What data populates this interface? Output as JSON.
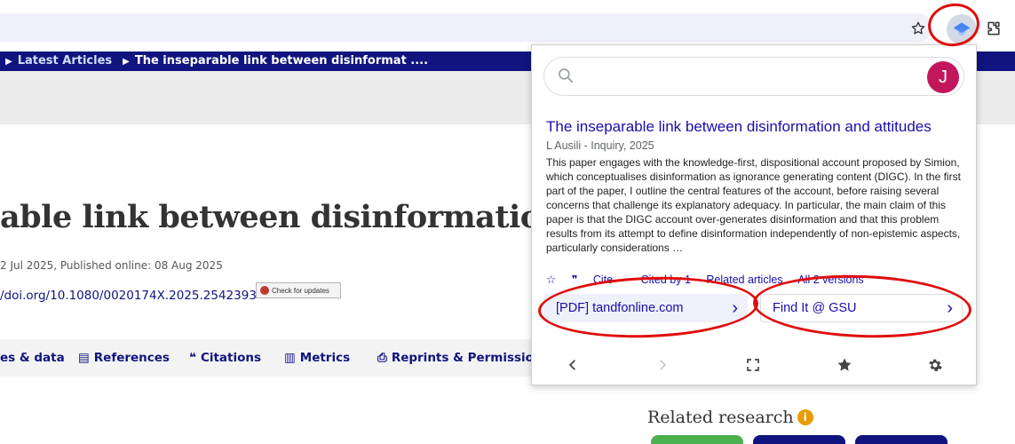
{
  "breadcrumb": {
    "latest": "Latest Articles",
    "current": "The inseparable link between disinformat ...."
  },
  "article": {
    "title": "able link between disinformation and",
    "dates": "2 Jul 2025, Published online: 08 Aug 2025",
    "doi": "/doi.org/10.1080/0020174X.2025.2542393",
    "check_updates": "Check for updates"
  },
  "tabs": [
    "es & data",
    "References",
    "Citations",
    "Metrics",
    "Reprints & Permissions"
  ],
  "related_research": "Related research",
  "popup": {
    "avatar_letter": "J",
    "result": {
      "title": "The inseparable link between disinformation and attitudes",
      "authors": "L Ausili - Inquiry, 2025",
      "snippet": "This paper engages with the knowledge-first, dispositional account proposed by Simion, which conceptualises disinformation as ignorance generating content (DIGC). In the first part of the paper, I outline the central features of the account, before raising several concerns that challenge its explanatory adequacy. In particular, the main claim of this paper is that the DIGC account over-generates disinformation and that this problem results from its attempt to define disinformation independently of non-epistemic aspects, particularly considerations …",
      "cite": "Cite",
      "cited_by": "Cited by 1",
      "related": "Related articles",
      "versions": "All 2 versions"
    },
    "pdf_button": "[PDF] tandfonline.com",
    "findit_button": "Find It @ GSU"
  },
  "colors": {
    "brand_navy": "#10147e",
    "scholar_link": "#1a0dab",
    "avatar": "#c2185b",
    "annotation": "#e00d0d"
  }
}
